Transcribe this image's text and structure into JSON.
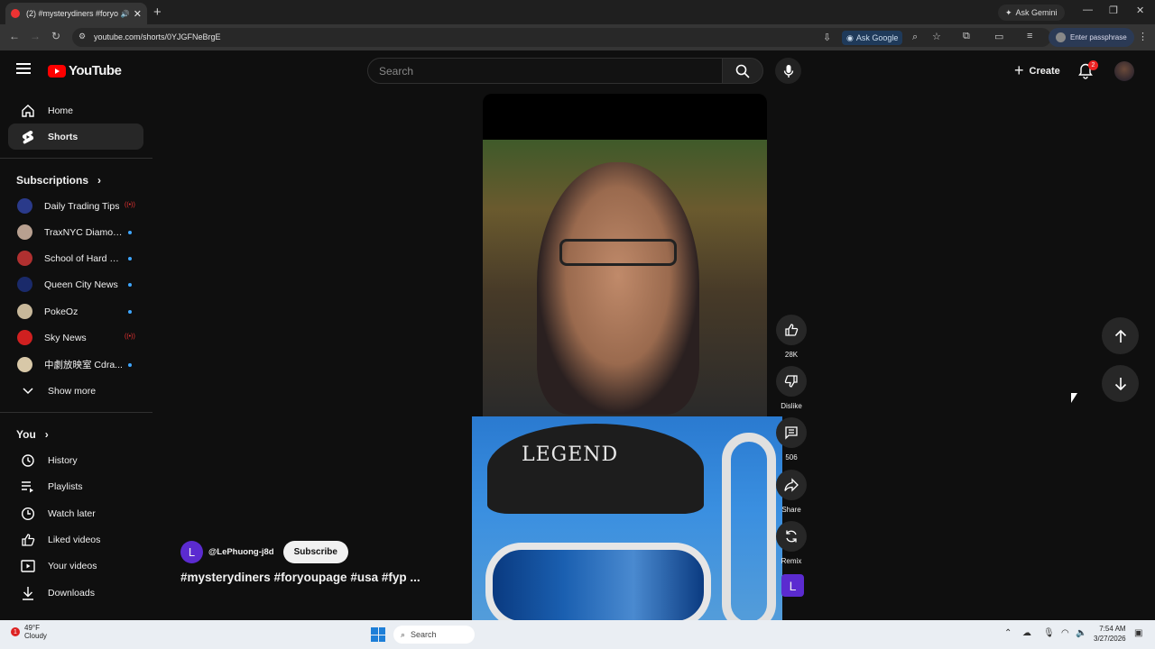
{
  "browser": {
    "tab_title": "(2) #mysterydiners #foryou",
    "new_tab": "+",
    "ask_gemini": "Ask Gemini",
    "url": "youtube.com/shorts/0YJGFNeBrgE",
    "ask_google": "Ask Google",
    "passphrase": "Enter passphrase"
  },
  "header": {
    "logo_text": "YouTube",
    "search_placeholder": "Search",
    "create_label": "Create",
    "notification_count": "2"
  },
  "sidebar": {
    "main": [
      {
        "label": "Home",
        "icon": "home-icon"
      },
      {
        "label": "Shorts",
        "icon": "shorts-icon",
        "active": true
      }
    ],
    "subscriptions_title": "Subscriptions",
    "subscriptions": [
      {
        "label": "Daily Trading Tips",
        "status": "live",
        "color": "#2a3a8a"
      },
      {
        "label": "TraxNYC Diamon...",
        "status": "new",
        "color": "#b8a090"
      },
      {
        "label": "School of Hard K...",
        "status": "new",
        "color": "#b03030"
      },
      {
        "label": "Queen City News",
        "status": "new",
        "color": "#1a2a6a"
      },
      {
        "label": "PokeOz",
        "status": "new",
        "color": "#c8b89a"
      },
      {
        "label": "Sky News",
        "status": "live",
        "color": "#d02020"
      },
      {
        "label": "中劇放映室 Cdra...",
        "status": "new",
        "color": "#d8c8a8"
      }
    ],
    "show_more": "Show more",
    "you_title": "You",
    "you_items": [
      {
        "label": "History",
        "icon": "history-icon"
      },
      {
        "label": "Playlists",
        "icon": "playlists-icon"
      },
      {
        "label": "Watch later",
        "icon": "watch-later-icon"
      },
      {
        "label": "Liked videos",
        "icon": "liked-videos-icon"
      },
      {
        "label": "Your videos",
        "icon": "your-videos-icon"
      },
      {
        "label": "Downloads",
        "icon": "downloads-icon"
      }
    ]
  },
  "short": {
    "channel_initial": "L",
    "channel_name": "@LePhuong-j8d",
    "subscribe_label": "Subscribe",
    "title": "#mysterydiners #foryoupage #usa #fyp ...",
    "overlay_text": "LEGEND",
    "likes": "28K",
    "dislike_label": "Dislike",
    "comments": "506",
    "share_label": "Share",
    "remix_label": "Remix",
    "sound_initial": "L"
  },
  "taskbar": {
    "temperature": "49°F",
    "condition": "Cloudy",
    "weather_badge": "1",
    "search_label": "Search",
    "time": "7:54 AM",
    "date": "3/27/2026"
  }
}
